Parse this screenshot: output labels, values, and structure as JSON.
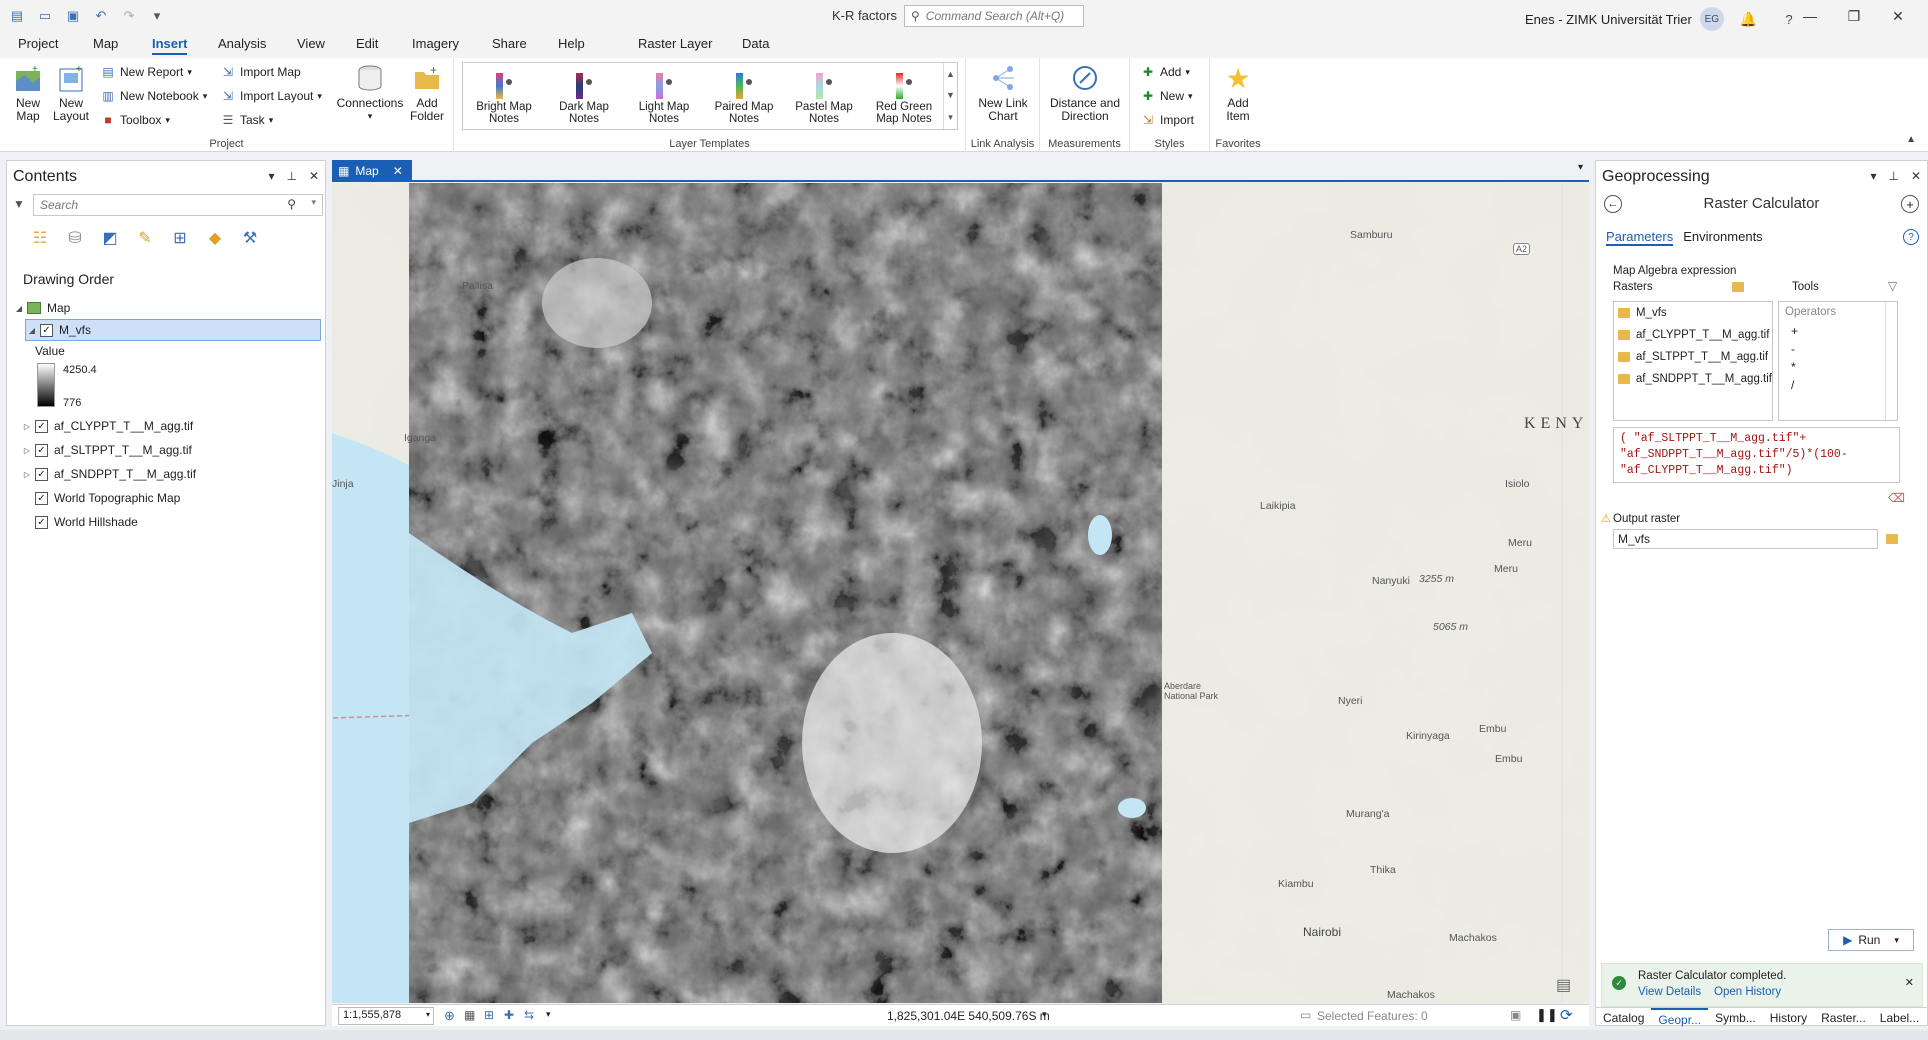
{
  "titlebar": {
    "project_name": "K-R factors",
    "command_search_placeholder": "Command Search (Alt+Q)",
    "user_name": "Enes - ZIMK Universität Trier",
    "user_initials": "EG"
  },
  "ribbon_tabs": [
    "Project",
    "Map",
    "Insert",
    "Analysis",
    "View",
    "Edit",
    "Imagery",
    "Share",
    "Help",
    "Raster Layer",
    "Data"
  ],
  "ribbon": {
    "project_group": {
      "label": "Project",
      "new_map": "New Map",
      "new_layout": "New Layout",
      "new_report": "New Report",
      "new_notebook": "New Notebook",
      "toolbox": "Toolbox",
      "import_map": "Import Map",
      "import_layout": "Import Layout",
      "task": "Task",
      "connections": "Connections",
      "add_folder": "Add Folder"
    },
    "layer_templates": {
      "label": "Layer Templates",
      "items": [
        "Bright Map Notes",
        "Dark Map Notes",
        "Light Map Notes",
        "Paired Map Notes",
        "Pastel Map Notes",
        "Red Green Map Notes"
      ]
    },
    "link_analysis": {
      "label": "Link Analysis",
      "button": "New Link Chart"
    },
    "measurements": {
      "label": "Measurements",
      "button": "Distance and Direction"
    },
    "styles": {
      "label": "Styles",
      "add": "Add",
      "new": "New",
      "import": "Import"
    },
    "favorites": {
      "label": "Favorites",
      "add_item": "Add Item"
    }
  },
  "contents": {
    "title": "Contents",
    "search_placeholder": "Search",
    "drawing_order_label": "Drawing Order",
    "map_name": "Map",
    "layers": [
      {
        "name": "M_vfs",
        "checked": true,
        "selected": true
      },
      {
        "name": "af_CLYPPT_T__M_agg.tif",
        "checked": true
      },
      {
        "name": "af_SLTPPT_T__M_agg.tif",
        "checked": true
      },
      {
        "name": "af_SNDPPT_T__M_agg.tif",
        "checked": true
      },
      {
        "name": "World Topographic Map",
        "checked": true
      },
      {
        "name": "World Hillshade",
        "checked": true
      }
    ],
    "legend": {
      "label": "Value",
      "max": "4250.4",
      "min": "776"
    }
  },
  "map": {
    "tab_label": "Map",
    "scale": "1:1,555,878",
    "coordinates": "1,825,301.04E 540,509.76S m",
    "selected_features": "Selected Features: 0",
    "place_labels": [
      "Pallisa",
      "Iganga",
      "Jinja",
      "Samburu",
      "Laikipia",
      "Isiolo",
      "Meru",
      "Meru",
      "Nanyuki",
      "3255 m",
      "5065 m",
      "Aberdare National Park",
      "Nyeri",
      "Kirinyaga",
      "Embu",
      "Embu",
      "Murang'a",
      "Kiambu",
      "Thika",
      "Nairobi",
      "Machakos",
      "Machakos",
      "KENY",
      "A2"
    ]
  },
  "geoprocessing": {
    "title": "Geoprocessing",
    "tool_name": "Raster Calculator",
    "tabs": [
      "Parameters",
      "Environments"
    ],
    "map_algebra_label": "Map Algebra expression",
    "rasters_label": "Rasters",
    "tools_label": "Tools",
    "operators_label": "Operators",
    "rasters": [
      "M_vfs",
      "af_CLYPPT_T__M_agg.tif",
      "af_SLTPPT_T__M_agg.tif",
      "af_SNDPPT_T__M_agg.tif"
    ],
    "operators": [
      "+",
      "-",
      "*",
      "/"
    ],
    "expression_lines": [
      "( \"af_SLTPPT_T__M_agg.tif\"+",
      "\"af_SNDPPT_T__M_agg.tif\"/5)*(100-",
      "\"af_CLYPPT_T__M_agg.tif\")"
    ],
    "output_raster_label": "Output raster",
    "output_raster_value": "M_vfs",
    "run_label": "Run",
    "notification": "Raster Calculator completed.",
    "view_details": "View Details",
    "open_history": "Open History",
    "bottom_tabs": [
      "Catalog",
      "Geopr...",
      "Symb...",
      "History",
      "Raster...",
      "Label..."
    ]
  },
  "colors": {
    "accent": "#1a5fb4",
    "water": "#c4e6f4",
    "land": "#ecebe3"
  }
}
